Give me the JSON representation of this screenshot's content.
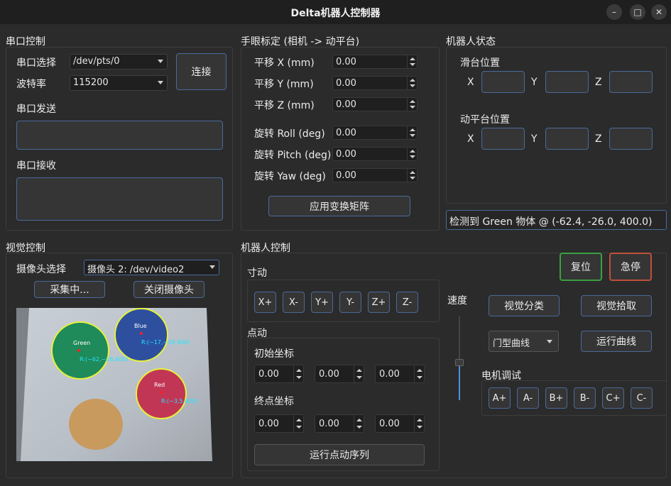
{
  "window": {
    "title": "Delta机器人控制器",
    "minimize": "–",
    "maximize": "□",
    "close": "✕"
  },
  "serial": {
    "section": "串口控制",
    "port_label": "串口选择",
    "port_value": "/dev/pts/0",
    "baud_label": "波特率",
    "baud_value": "115200",
    "connect": "连接",
    "send_label": "串口发送",
    "recv_label": "串口接收"
  },
  "handeye": {
    "section": "手眼标定 (相机 -> 动平台)",
    "rows": [
      {
        "label": "平移 X (mm)",
        "value": "0.00"
      },
      {
        "label": "平移 Y (mm)",
        "value": "0.00"
      },
      {
        "label": "平移 Z (mm)",
        "value": "0.00"
      },
      {
        "label": "旋转 Roll (deg)",
        "value": "0.00"
      },
      {
        "label": "旋转 Pitch (deg)",
        "value": "0.00"
      },
      {
        "label": "旋转 Yaw (deg)",
        "value": "0.00"
      }
    ],
    "apply": "应用变换矩阵"
  },
  "robot_status": {
    "section": "机器人状态",
    "slide_label": "滑台位置",
    "platform_label": "动平台位置",
    "x": "X",
    "y": "Y",
    "z": "Z"
  },
  "detection": "检测到 Green 物体 @ (-62.4, -26.0, 400.0)",
  "vision": {
    "section": "视觉控制",
    "camera_label": "摄像头选择",
    "camera_value": "摄像头 2: /dev/video2",
    "capture": "采集中...",
    "close_camera": "关闭摄像头",
    "objects": [
      {
        "name": "Green",
        "coords": "R:(−62,−26,400)",
        "color": "#1f8a5a"
      },
      {
        "name": "Blue",
        "coords": "R:(−17,−39,400)",
        "color": "#2d4f9e"
      },
      {
        "name": "Red",
        "coords": "R:(−3,5,400)",
        "color": "#c23655"
      }
    ]
  },
  "robot_control": {
    "section": "机器人控制",
    "reset": "复位",
    "estop": "急停",
    "jog_label": "寸动",
    "jog_buttons": [
      "X+",
      "X-",
      "Y+",
      "Y-",
      "Z+",
      "Z-"
    ],
    "point_label": "点动",
    "start_label": "初始坐标",
    "end_label": "终点坐标",
    "start_values": [
      "0.00",
      "0.00",
      "0.00"
    ],
    "end_values": [
      "0.00",
      "0.00",
      "0.00"
    ],
    "run_points": "运行点动序列",
    "speed_label": "速度",
    "speed_level": 0.45,
    "vision_classify": "视觉分类",
    "vision_pick": "视觉拾取",
    "curve_value": "门型曲线",
    "run_curve": "运行曲线",
    "motor_label": "电机调试",
    "motor_buttons": [
      "A+",
      "A-",
      "B+",
      "B-",
      "C+",
      "C-"
    ]
  },
  "colors": {
    "accent_border": "#4a6a9a",
    "reset_border": "#3aa040",
    "estop_border": "#c0503a",
    "highlight_ring": "#e6f23a",
    "label_cyan": "#22e6ff"
  }
}
